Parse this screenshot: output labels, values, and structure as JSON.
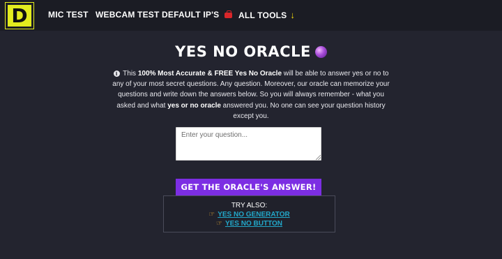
{
  "header": {
    "logo_letter": "D",
    "nav": [
      {
        "label": "MIC TEST"
      },
      {
        "label": "WEBCAM TEST"
      },
      {
        "label": "DEFAULT IP'S"
      },
      {
        "label": "ALL TOOLS",
        "icon": "toolbox-icon",
        "suffix_icon": "arrow-down-icon"
      }
    ]
  },
  "main": {
    "title": "YES NO ORACLE",
    "title_icon": "crystal-ball-icon",
    "intro_segments": [
      {
        "text": " This ",
        "bold": false
      },
      {
        "text": "100% Most Accurate & FREE Yes No Oracle",
        "bold": true
      },
      {
        "text": " will be able to answer yes or no to any of your most secret questions. Any question. Moreover, our oracle can memorize your questions and write down the answers below. So you will always remember - what you asked and what ",
        "bold": false
      },
      {
        "text": "yes or no oracle",
        "bold": true
      },
      {
        "text": " answered you. No one can see your question history except you.",
        "bold": false
      }
    ],
    "question_placeholder": "Enter your question...",
    "question_value": "",
    "answer_button": "GET THE ORACLE'S ANSWER!",
    "try_also": {
      "title": "TRY ALSO:",
      "links": [
        {
          "label": "YES NO GENERATOR",
          "icon": "pointing-hand-icon"
        },
        {
          "label": "YES NO BUTTON",
          "icon": "pointing-hand-icon"
        }
      ]
    }
  },
  "colors": {
    "background": "#22232d",
    "header_background": "#1b1c24",
    "logo_yellow": "#e3ec1f",
    "accent_purple": "#7c2ee3",
    "link_cyan": "#22a7c9"
  }
}
